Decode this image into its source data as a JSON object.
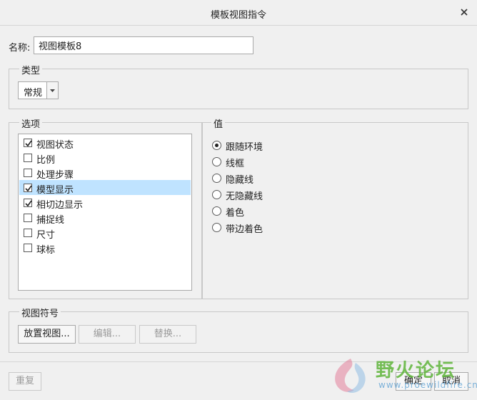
{
  "dialog": {
    "title": "模板视图指令"
  },
  "name": {
    "label": "名称:",
    "value": "视图模板8"
  },
  "type_group": {
    "title": "类型",
    "selected": "常规"
  },
  "options_group": {
    "title": "选项",
    "items": [
      {
        "label": "视图状态",
        "checked": true,
        "selected": false
      },
      {
        "label": "比例",
        "checked": false,
        "selected": false
      },
      {
        "label": "处理步骤",
        "checked": false,
        "selected": false
      },
      {
        "label": "模型显示",
        "checked": true,
        "selected": true
      },
      {
        "label": "相切边显示",
        "checked": true,
        "selected": false
      },
      {
        "label": "捕捉线",
        "checked": false,
        "selected": false
      },
      {
        "label": "尺寸",
        "checked": false,
        "selected": false
      },
      {
        "label": "球标",
        "checked": false,
        "selected": false
      }
    ]
  },
  "value_group": {
    "title": "值",
    "options": [
      {
        "label": "跟随环境",
        "selected": true
      },
      {
        "label": "线框",
        "selected": false
      },
      {
        "label": "隐藏线",
        "selected": false
      },
      {
        "label": "无隐藏线",
        "selected": false
      },
      {
        "label": "着色",
        "selected": false
      },
      {
        "label": "带边着色",
        "selected": false
      }
    ]
  },
  "symbol_group": {
    "title": "视图符号",
    "place_label": "放置视图...",
    "edit_label": "编辑...",
    "replace_label": "替换..."
  },
  "footer": {
    "reset_label": "重复",
    "ok_label": "确定",
    "cancel_label": "取消"
  },
  "watermark": {
    "text": "野火论坛",
    "url": "www.proewildfire.cn"
  }
}
